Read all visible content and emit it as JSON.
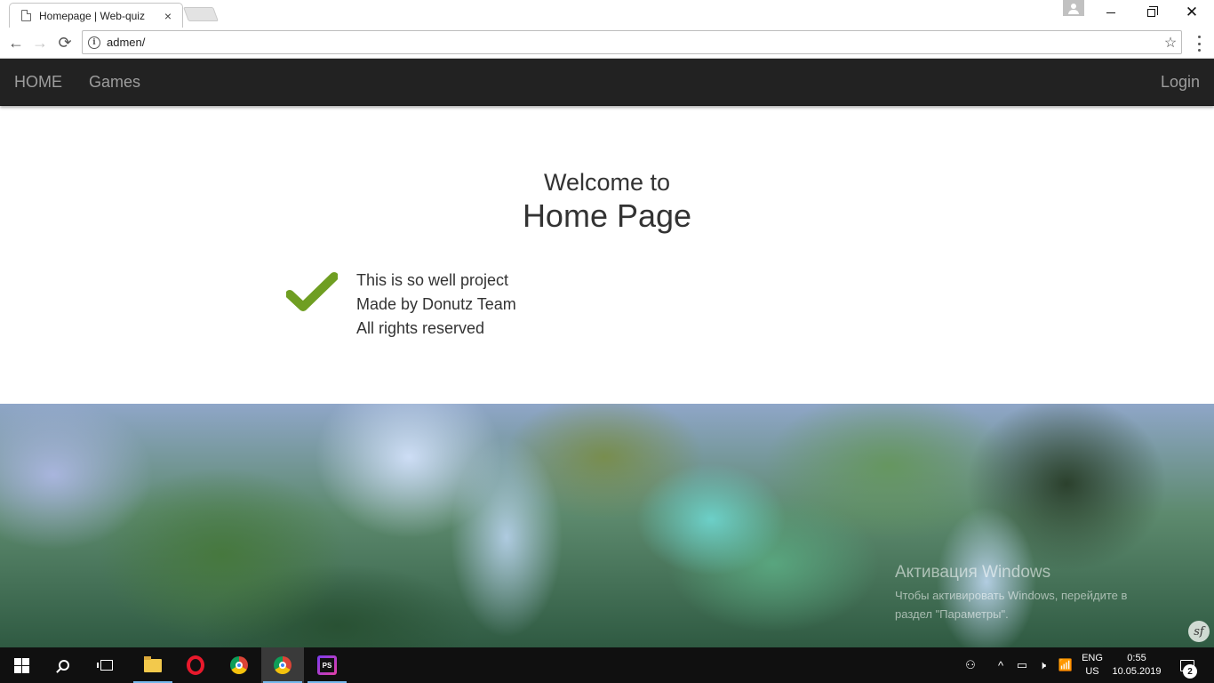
{
  "browser": {
    "tab_title": "Homepage | Web-quiz",
    "tab_close": "×",
    "url": "admen/",
    "info_glyph": "i",
    "star_glyph": "☆",
    "back_glyph": "←",
    "forward_glyph": "→",
    "reload_glyph": "⟳",
    "close_glyph": "✕"
  },
  "navbar": {
    "home": "HOME",
    "games": "Games",
    "login": "Login"
  },
  "content": {
    "welcome": "Welcome to",
    "title": "Home Page",
    "lines": [
      "This is so well project",
      "Made by Donutz Team",
      "All rights reserved"
    ],
    "check_color": "#6f9e22"
  },
  "overlay": {
    "activation_title": "Активация Windows",
    "activation_line1": "Чтобы активировать Windows, перейдите в",
    "activation_line2": "раздел \"Параметры\".",
    "sf_badge": "sf"
  },
  "taskbar": {
    "apps": [
      "start-button",
      "search",
      "task-view",
      "file-explorer",
      "opera",
      "chrome",
      "chrome",
      "phpstorm"
    ],
    "ps_label": "PS",
    "lang_top": "ENG",
    "lang_bottom": "US",
    "time": "0:55",
    "date": "10.05.2019",
    "notif_count": "2",
    "tray_chevron": "^",
    "volume_glyph": "🕨",
    "network_glyph": "📶",
    "battery_glyph": "▭",
    "people_glyph": "⚇"
  }
}
